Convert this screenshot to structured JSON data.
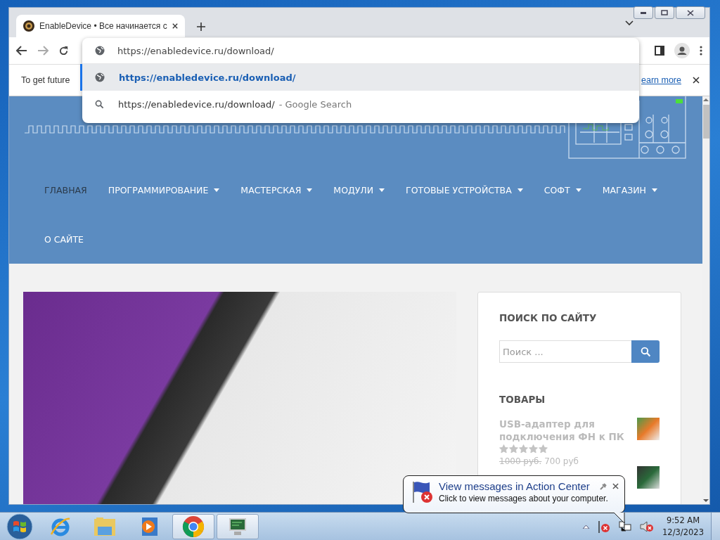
{
  "browser": {
    "tabs": [
      {
        "title": "EnableDevice • Все начинается с",
        "selected": true
      }
    ],
    "address": {
      "value": "https://enabledevice.ru/download/"
    },
    "suggestions": [
      {
        "kind": "url",
        "text": "https://enabledevice.ru/download/",
        "selected": true
      },
      {
        "kind": "search",
        "text": "https://enabledevice.ru/download/",
        "suffix": "- Google Search",
        "selected": false
      }
    ],
    "infobar": {
      "text": "To get future",
      "link": "earn more"
    }
  },
  "site": {
    "nav": [
      {
        "label": "ГЛАВНАЯ",
        "has_menu": false,
        "selected": true
      },
      {
        "label": "ПРОГРАММИРОВАНИЕ",
        "has_menu": true,
        "selected": false
      },
      {
        "label": "МАСТЕРСКАЯ",
        "has_menu": true,
        "selected": false
      },
      {
        "label": "МОДУЛИ",
        "has_menu": true,
        "selected": false
      },
      {
        "label": "ГОТОВЫЕ УСТРОЙСТВА",
        "has_menu": true,
        "selected": false
      },
      {
        "label": "СОФТ",
        "has_menu": true,
        "selected": false
      },
      {
        "label": "МАГАЗИН",
        "has_menu": true,
        "selected": false
      },
      {
        "label": "О САЙТЕ",
        "has_menu": false,
        "selected": false
      }
    ],
    "sidebar": {
      "search_title": "ПОИСК ПО САЙТУ",
      "search_placeholder": "Поиск ...",
      "products_title": "ТОВАРЫ",
      "products": [
        {
          "name": "USB-адаптер для подключения ФН к ПК",
          "stars": 0,
          "old_price": "1000 руб.",
          "price": "700 руб"
        }
      ]
    }
  },
  "balloon": {
    "title": "View messages in Action Center",
    "text": "Click to view messages about your computer."
  },
  "taskbar": {
    "apps": [
      {
        "kind": "ie",
        "running": false
      },
      {
        "kind": "explorer",
        "running": false
      },
      {
        "kind": "media",
        "running": false
      },
      {
        "kind": "chrome",
        "running": true
      },
      {
        "kind": "monitor",
        "running": true
      }
    ],
    "time": "9:52 AM",
    "date": "12/3/2023"
  }
}
